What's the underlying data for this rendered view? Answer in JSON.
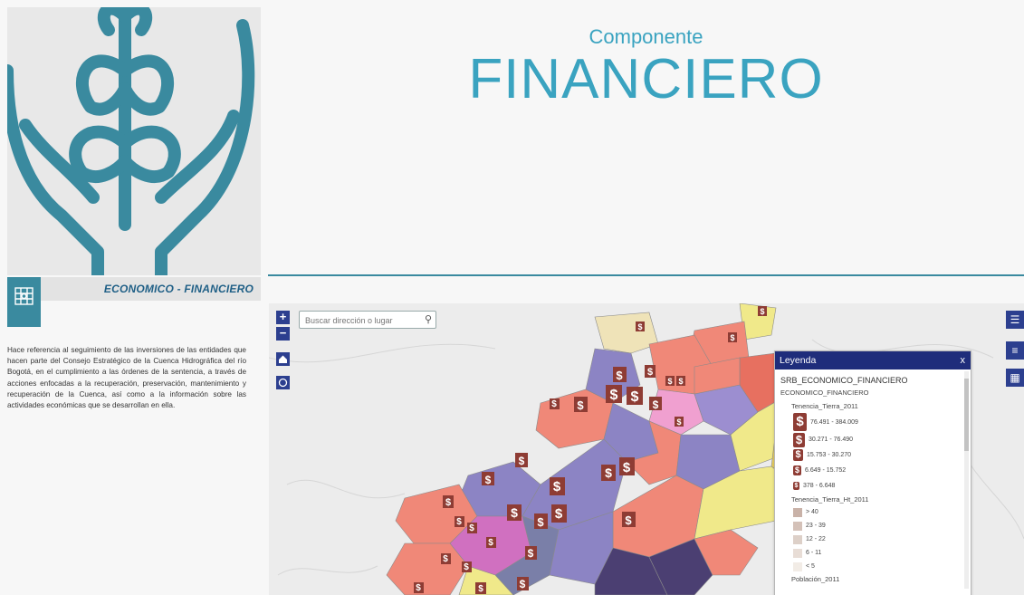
{
  "hero": {
    "section_title": "ECONOMICO - FINANCIERO",
    "description": "Hace referencia al seguimiento de las inversiones de las entidades que hacen parte del Consejo Estratégico de la Cuenca Hidrográfica del río Bogotá, en el cumplimiento a las órdenes de la sentencia, a través de acciones enfocadas a la recuperación, preservación, mantenimiento y recuperación de la Cuenca, así como a la información sobre las actividades económicas que se desarrollan en ella."
  },
  "header": {
    "subtitle": "Componente",
    "title": "FINANCIERO"
  },
  "map": {
    "search_placeholder": "Buscar dirección o lugar",
    "zoom_in": "+",
    "zoom_out": "−"
  },
  "legend": {
    "title": "Leyenda",
    "close_label": "x",
    "service": "SRB_ECONOMICO_FINANCIERO",
    "layer": "ECONOMICO_FINANCIERO",
    "group1_label": "Tenencia_Tierra_2011",
    "group1": [
      "76.491 - 384.009",
      "30.271 - 76.490",
      "15.753 - 30.270",
      "6.649 - 15.752",
      "378 - 6.648"
    ],
    "group2_label": "Tenencia_Tierra_Ht_2011",
    "group2": [
      "> 40",
      "23 - 39",
      "12 - 22",
      "6 - 11",
      "< 5"
    ],
    "group3_label": "Población_2011"
  },
  "colors": {
    "accent": "#3aa3c0",
    "dark_blue": "#1f2d7b",
    "icon_red": "#8e3c34"
  }
}
